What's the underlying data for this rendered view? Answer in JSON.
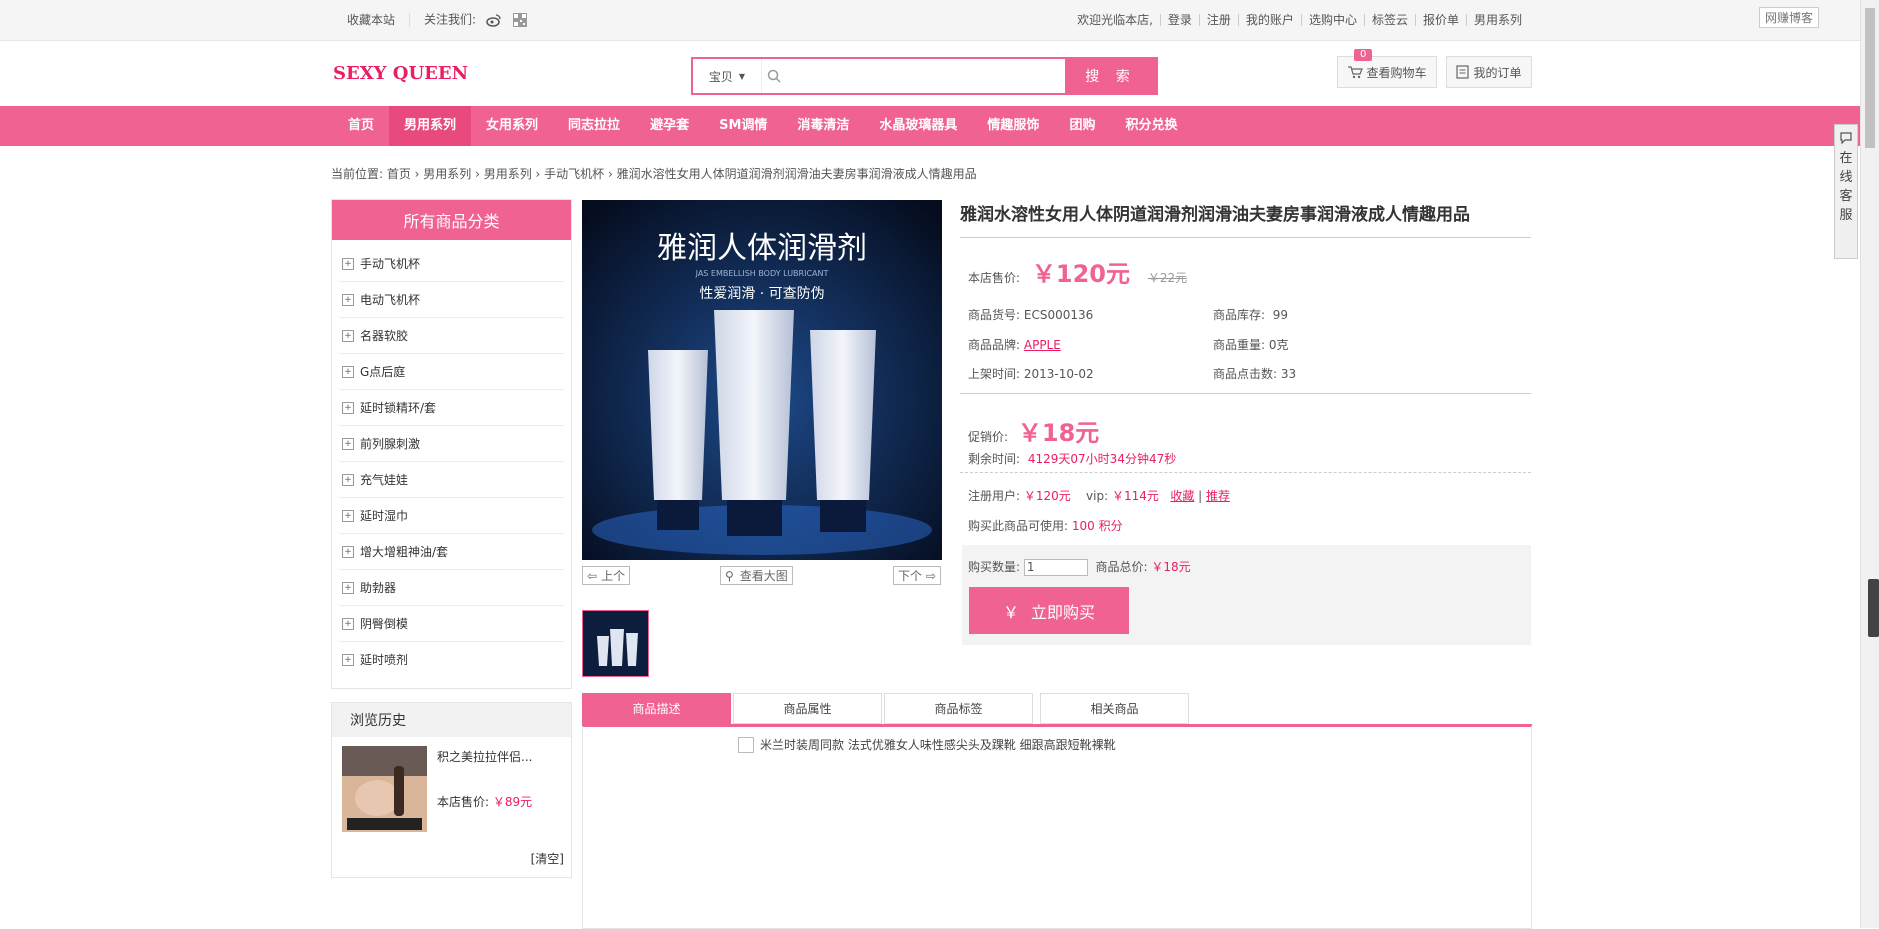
{
  "topbar": {
    "favorite": "收藏本站",
    "follow": "关注我们:",
    "links": [
      "欢迎光临本店,",
      "登录",
      "注册",
      "我的账户",
      "选购中心",
      "标签云",
      "报价单",
      "男用系列"
    ],
    "badge": "网赚博客"
  },
  "header": {
    "logo": "SEXY QUEEN",
    "search_category": "宝贝",
    "search_placeholder": "",
    "search_button": "搜 索",
    "cart_count": "0",
    "cart_label": "查看购物车",
    "orders_label": "我的订单"
  },
  "nav": {
    "items": [
      "首页",
      "男用系列",
      "女用系列",
      "同志拉拉",
      "避孕套",
      "SM调情",
      "消毒清洁",
      "水晶玻璃器具",
      "情趣服饰",
      "团购",
      "积分兑换"
    ],
    "active_index": 1
  },
  "breadcrumb": "当前位置: 首页 › 男用系列 › 男用系列 › 手动飞机杯 › 雅润水溶性女用人体阴道润滑剂润滑油夫妻房事润滑液成人情趣用品",
  "sidebar": {
    "title": "所有商品分类",
    "categories": [
      "手动飞机杯",
      "电动飞机杯",
      "名器软胶",
      "G点后庭",
      "延时锁精环/套",
      "前列腺刺激",
      "充气娃娃",
      "延时湿巾",
      "增大增粗神油/套",
      "助勃器",
      "阴臀倒模",
      "延时喷剂"
    ],
    "history_title": "浏览历史",
    "history_name": "积之美拉拉伴侣...",
    "history_price_label": "本店售价:",
    "history_price": "￥89元",
    "history_clear": "[清空]"
  },
  "gallery": {
    "image_text_main": "雅润人体润滑剂",
    "image_text_en": "JAS EMBELLISH BODY LUBRICANT",
    "image_text_sub": "性爱润滑 · 可查防伪",
    "prev": "上个",
    "view_large": "查看大图",
    "next": "下个"
  },
  "product": {
    "title": "雅润水溶性女用人体阴道润滑剂润滑油夫妻房事润滑液成人情趣用品",
    "shop_price_label": "本店售价:",
    "shop_price": "￥120元",
    "market_price": "￥22元",
    "sn_label": "商品货号:",
    "sn": "ECS000136",
    "stock_label": "商品库存:",
    "stock": "99",
    "brand_label": "商品品牌:",
    "brand": "APPLE",
    "weight_label": "商品重量:",
    "weight": "0克",
    "added_label": "上架时间:",
    "added": "2013-10-02",
    "clicks_label": "商品点击数:",
    "clicks": "33",
    "promo_label": "促销价:",
    "promo_price": "￥18元",
    "remain_label": "剩余时间:",
    "remain": "4129天07小时34分钟47秒",
    "member_label": "注册用户:",
    "member_price": "￥120元",
    "vip_label": "vip:",
    "vip_price": "￥114元",
    "collect": "收藏",
    "recommend": "推荐",
    "points_label": "购买此商品可使用:",
    "points": "100",
    "points_unit": "积分",
    "qty_label": "购买数量:",
    "qty_value": "1",
    "total_label": "商品总价:",
    "total": "￥18元",
    "buy": "立即购买",
    "buy_icon": "￥"
  },
  "tabs": [
    "商品描述",
    "商品属性",
    "商品标签",
    "相关商品"
  ],
  "description": "米兰时装周同款 法式优雅女人味性感尖头及踝靴 细跟高跟短靴裸靴",
  "service": [
    "在",
    "线",
    "客",
    "服"
  ],
  "colors": {
    "accent": "#f06292",
    "price": "#e91e63"
  }
}
